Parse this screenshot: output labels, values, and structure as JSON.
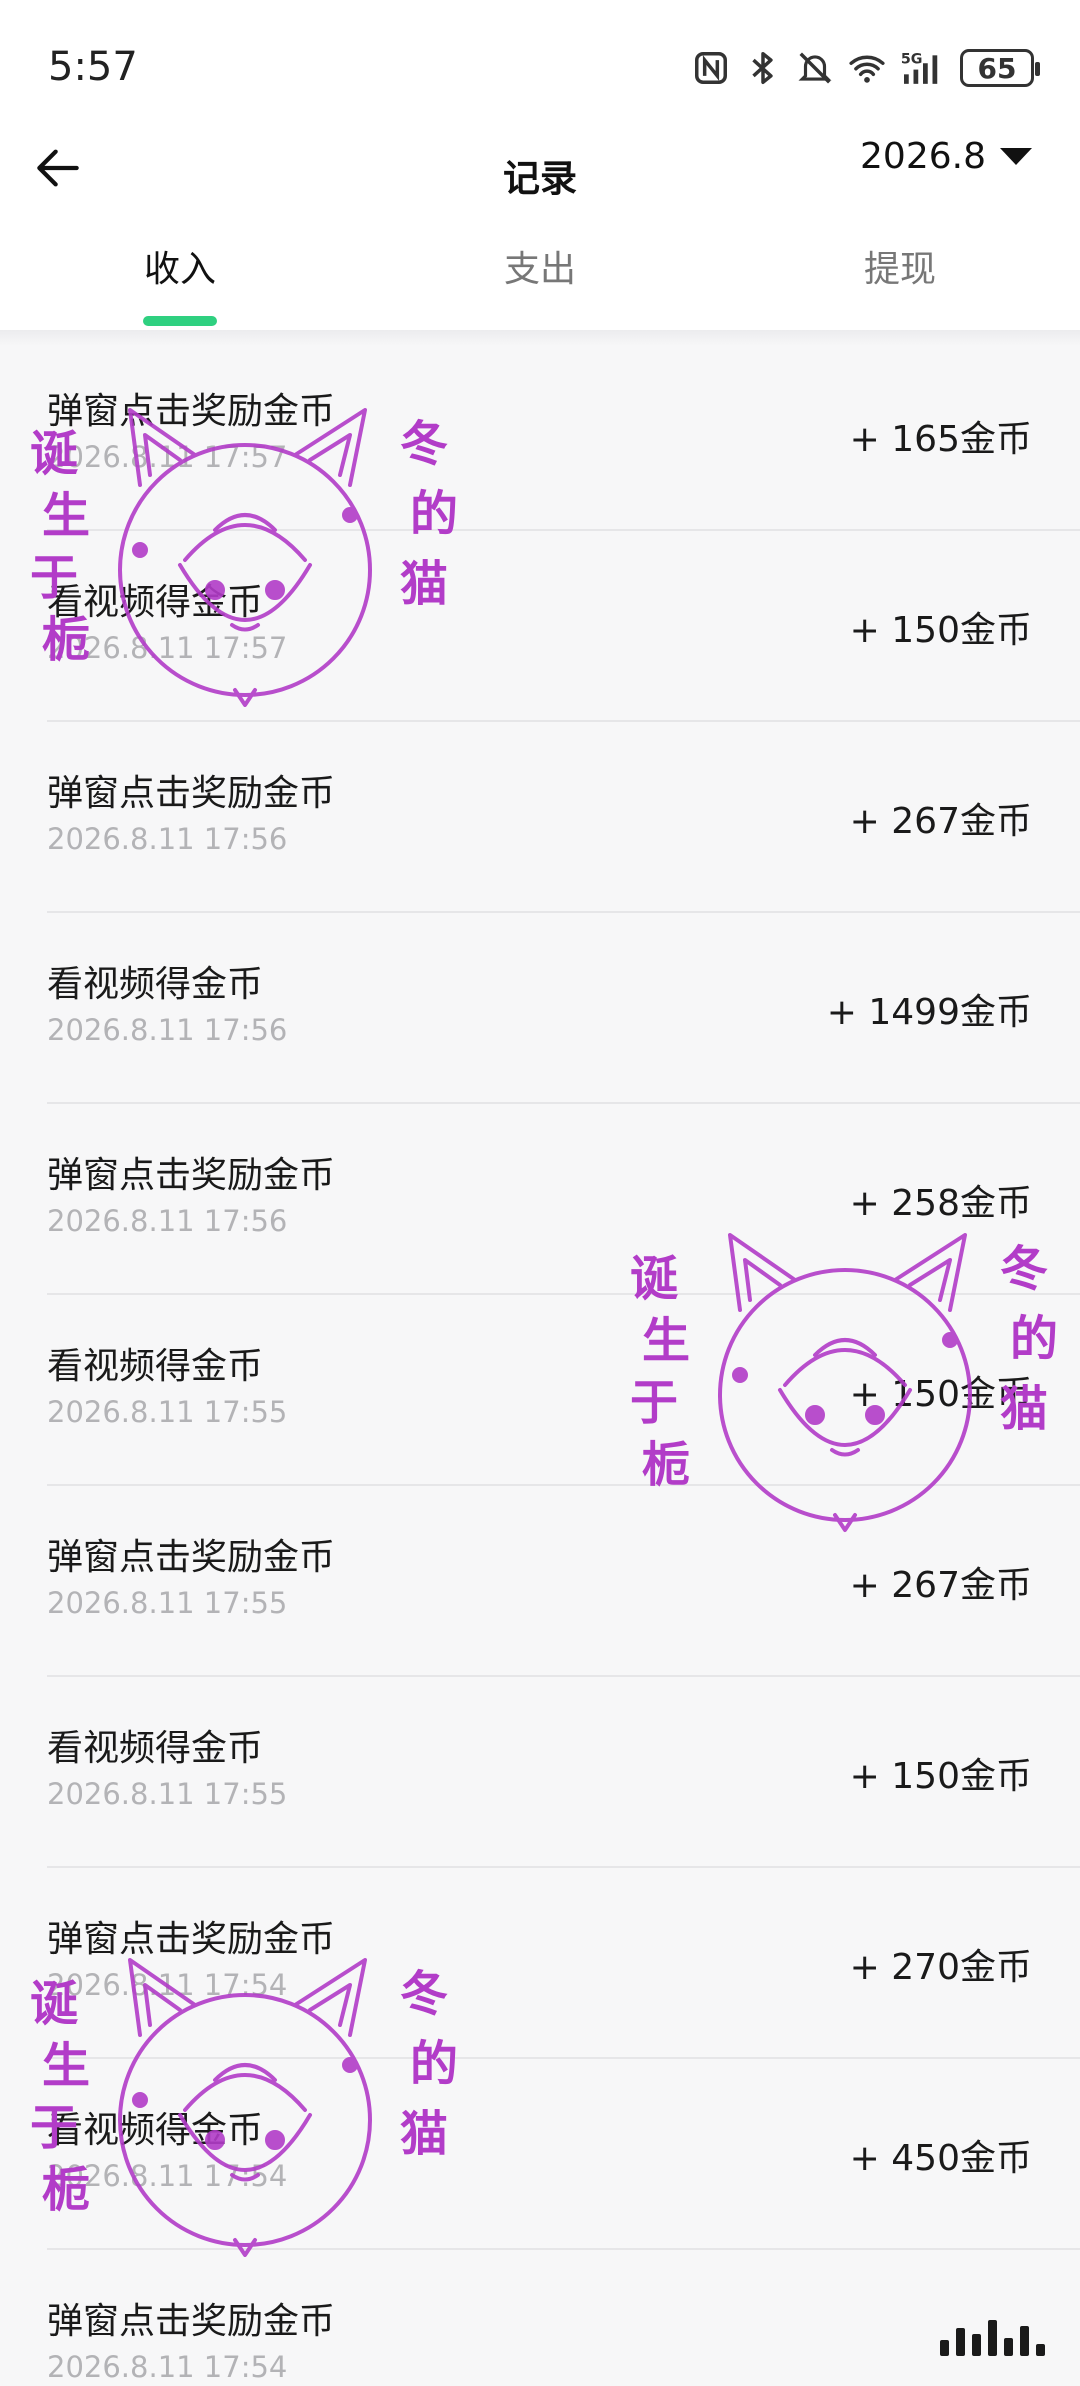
{
  "status_bar": {
    "time": "5:57",
    "network": "5G",
    "battery": "65",
    "icons": [
      "nfc-icon",
      "bluetooth-icon",
      "mute-icon",
      "wifi-icon",
      "signal-icon",
      "battery-icon"
    ]
  },
  "header": {
    "title": "记录",
    "month": "2026.8"
  },
  "tabs": [
    {
      "label": "收入",
      "active": true
    },
    {
      "label": "支出",
      "active": false
    },
    {
      "label": "提现",
      "active": false
    }
  ],
  "records": [
    {
      "name": "弹窗点击奖励金币",
      "date": "2026.8.11 17:57",
      "amount": "+ 165金币"
    },
    {
      "name": "看视频得金币",
      "date": "2026.8.11 17:57",
      "amount": "+ 150金币"
    },
    {
      "name": "弹窗点击奖励金币",
      "date": "2026.8.11 17:56",
      "amount": "+ 267金币"
    },
    {
      "name": "看视频得金币",
      "date": "2026.8.11 17:56",
      "amount": "+ 1499金币"
    },
    {
      "name": "弹窗点击奖励金币",
      "date": "2026.8.11 17:56",
      "amount": "+ 258金币"
    },
    {
      "name": "看视频得金币",
      "date": "2026.8.11 17:55",
      "amount": "+ 150金币"
    },
    {
      "name": "弹窗点击奖励金币",
      "date": "2026.8.11 17:55",
      "amount": "+ 267金币"
    },
    {
      "name": "看视频得金币",
      "date": "2026.8.11 17:55",
      "amount": "+ 150金币"
    },
    {
      "name": "弹窗点击奖励金币",
      "date": "2026.8.11 17:54",
      "amount": "+ 270金币"
    },
    {
      "name": "看视频得金币",
      "date": "2026.8.11 17:54",
      "amount": "+ 450金币"
    },
    {
      "name": "弹窗点击奖励金币",
      "date": "2026.8.11 17:54",
      "amount": ""
    }
  ],
  "watermark": {
    "text_left": "诞生于栀",
    "text_right": "冬的猫",
    "color": "#b23cc8"
  },
  "colors": {
    "tab_indicator": "#2fd080",
    "date_text": "#b3b3b6"
  }
}
